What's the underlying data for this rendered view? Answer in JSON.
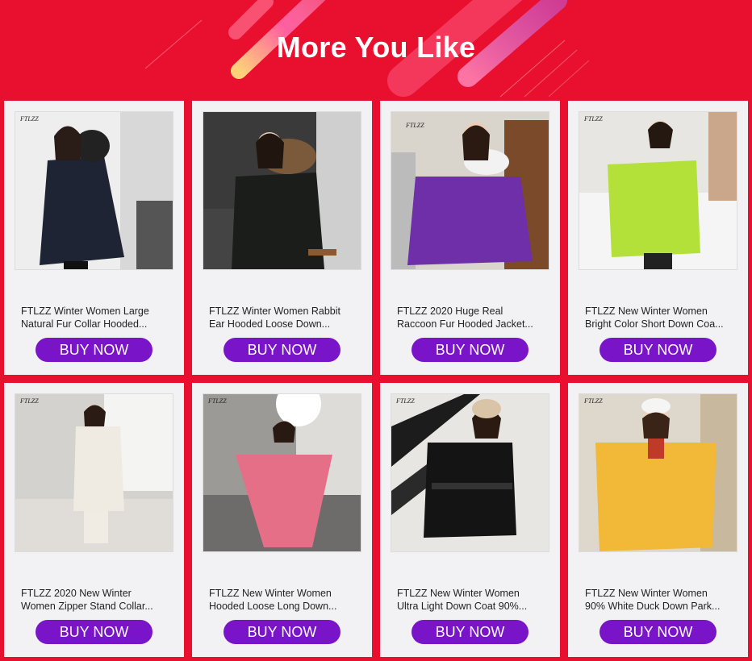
{
  "banner": {
    "title": "More You Like"
  },
  "colors": {
    "background": "#e8102e",
    "button": "#7a14c8",
    "card": "#f2f2f4"
  },
  "products": [
    {
      "brand_mark": "FTLZZ",
      "title_line1": "FTLZZ Winter Women Large",
      "title_line2": "Natural Fur Collar Hooded...",
      "button_label": "BUY NOW",
      "image": "woman-black-parka-fur-hood"
    },
    {
      "brand_mark": "",
      "title_line1": "FTLZZ Winter Women Rabbit",
      "title_line2": "Ear Hooded Loose Down...",
      "button_label": "BUY NOW",
      "image": "woman-black-quilted-fur-hood"
    },
    {
      "brand_mark": "FTLZZ",
      "title_line1": "FTLZZ 2020 Huge Real",
      "title_line2": "Raccoon Fur Hooded Jacket...",
      "button_label": "BUY NOW",
      "image": "woman-purple-jacket-fur-hood"
    },
    {
      "brand_mark": "FTLZZ",
      "title_line1": "FTLZZ New Winter Women",
      "title_line2": "Bright Color Short Down Coa...",
      "button_label": "BUY NOW",
      "image": "woman-lime-puffer"
    },
    {
      "brand_mark": "FTLZZ",
      "title_line1": "FTLZZ 2020 New Winter",
      "title_line2": "Women Zipper Stand Collar...",
      "button_label": "BUY NOW",
      "image": "woman-white-long-puffer"
    },
    {
      "brand_mark": "FTLZZ",
      "title_line1": "FTLZZ New Winter Women",
      "title_line2": "Hooded Loose Long Down...",
      "button_label": "BUY NOW",
      "image": "woman-pink-long-puffer"
    },
    {
      "brand_mark": "FTLZZ",
      "title_line1": "FTLZZ New Winter Women",
      "title_line2": "Ultra Light Down Coat 90%...",
      "button_label": "BUY NOW",
      "image": "woman-black-belted-coat"
    },
    {
      "brand_mark": "FTLZZ",
      "title_line1": "FTLZZ New Winter Women",
      "title_line2": "90% White Duck Down Park...",
      "button_label": "BUY NOW",
      "image": "woman-yellow-puffer"
    }
  ]
}
